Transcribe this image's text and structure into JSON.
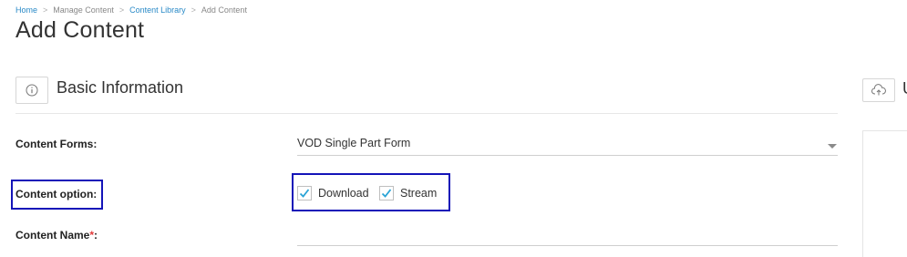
{
  "breadcrumb": {
    "items": [
      "Home",
      "Manage Content",
      "Content Library",
      "Add Content"
    ],
    "separator": ">"
  },
  "page_title": "Add Content",
  "section": {
    "title": "Basic Information",
    "icon": "info-circle-icon"
  },
  "right_panel": {
    "icon": "cloud-upload-icon",
    "title_fragment": "U"
  },
  "form": {
    "content_forms": {
      "label": "Content Forms:",
      "value": "VOD Single Part Form"
    },
    "content_option": {
      "label": "Content option:",
      "options": [
        {
          "label": "Download",
          "checked": true
        },
        {
          "label": "Stream",
          "checked": true
        }
      ]
    },
    "content_name": {
      "label": "Content Name",
      "required_marker": "*",
      "label_suffix": ":",
      "value": ""
    }
  },
  "colors": {
    "link": "#2a8ac7",
    "highlight": "#1414b8",
    "check": "#29a3d6",
    "required": "#e23b3b"
  }
}
